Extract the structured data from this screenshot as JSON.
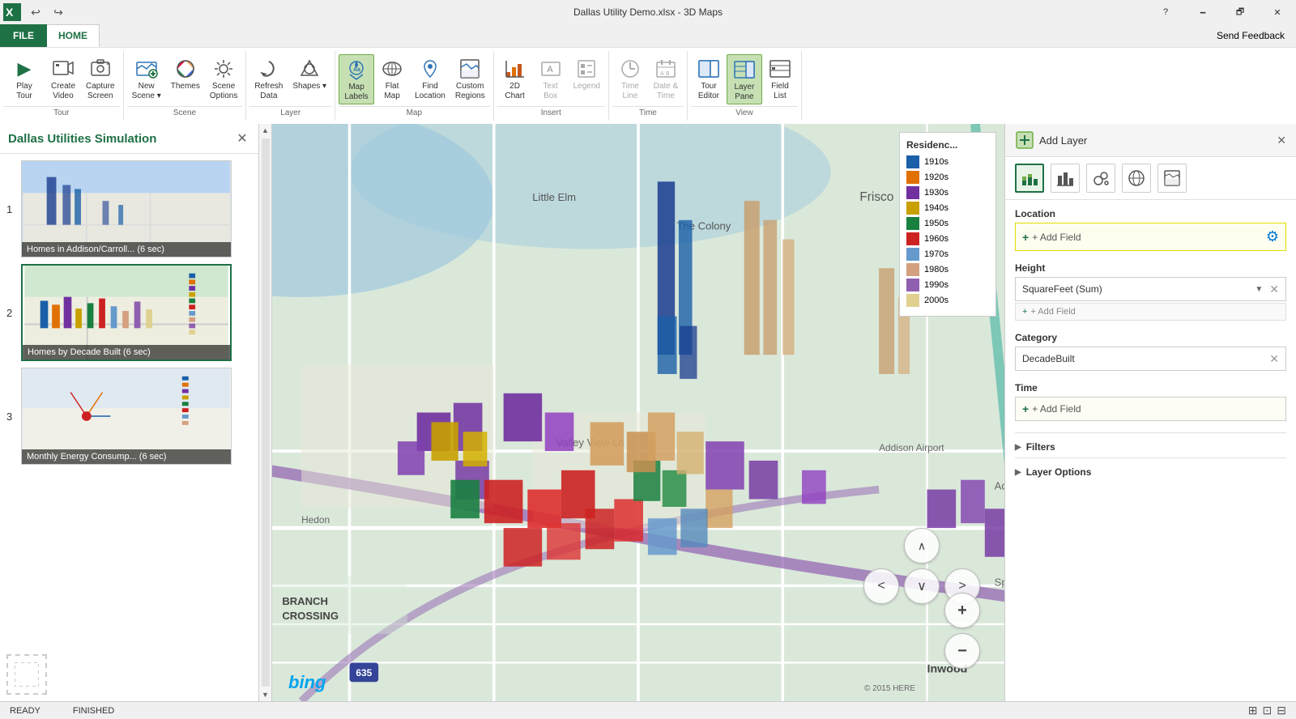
{
  "titlebar": {
    "title": "Dallas Utility Demo.xlsx - 3D Maps",
    "help": "?",
    "minimize": "🗕",
    "maximize": "🗗",
    "close": "✕",
    "undo": "↩",
    "redo": "↪"
  },
  "tabs": {
    "file": "FILE",
    "home": "HOME",
    "send_feedback": "Send Feedback"
  },
  "ribbon_groups": {
    "tour": {
      "label": "Tour",
      "buttons": [
        {
          "id": "play-tour",
          "label": "Play\nTour",
          "icon": "▶",
          "icon_color": "green"
        },
        {
          "id": "create-video",
          "label": "Create\nVideo",
          "icon": "🎬"
        },
        {
          "id": "capture-screen",
          "label": "Capture\nScreen",
          "icon": "📷"
        }
      ]
    },
    "scene": {
      "label": "Scene",
      "buttons": [
        {
          "id": "new-scene",
          "label": "New\nScene",
          "icon": "🏔",
          "has_arrow": true
        },
        {
          "id": "themes",
          "label": "Themes",
          "icon": "🎨"
        },
        {
          "id": "scene-options",
          "label": "Scene\nOptions",
          "icon": "⚙"
        }
      ]
    },
    "layer": {
      "label": "Layer",
      "buttons": [
        {
          "id": "refresh-data",
          "label": "Refresh\nData",
          "icon": "🔄"
        },
        {
          "id": "shapes",
          "label": "Shapes",
          "icon": "⬡",
          "has_arrow": true
        }
      ]
    },
    "map": {
      "label": "Map",
      "buttons": [
        {
          "id": "map-labels",
          "label": "Map\nLabels",
          "icon": "🗺",
          "active": true
        },
        {
          "id": "flat-map",
          "label": "Flat\nMap",
          "icon": "📋"
        },
        {
          "id": "find-location",
          "label": "Find\nLocation",
          "icon": "📍"
        },
        {
          "id": "custom-regions",
          "label": "Custom\nRegions",
          "icon": "🗾"
        }
      ]
    },
    "insert": {
      "label": "Insert",
      "buttons": [
        {
          "id": "2d-chart",
          "label": "2D\nChart",
          "icon": "📊"
        },
        {
          "id": "text-box",
          "label": "Text\nBox",
          "icon": "🔤",
          "disabled": true
        },
        {
          "id": "legend",
          "label": "Legend",
          "icon": "📋",
          "disabled": true
        }
      ]
    },
    "time": {
      "label": "Time",
      "buttons": [
        {
          "id": "time-line",
          "label": "Time\nLine",
          "icon": "⏱",
          "disabled": true
        },
        {
          "id": "date-time",
          "label": "Date &\nTime",
          "icon": "📅",
          "disabled": true
        }
      ]
    },
    "view": {
      "label": "View",
      "buttons": [
        {
          "id": "tour-editor",
          "label": "Tour\nEditor",
          "icon": "🎬"
        },
        {
          "id": "layer-pane",
          "label": "Layer\nPane",
          "icon": "▦",
          "active": true
        },
        {
          "id": "field-list",
          "label": "Field\nList",
          "icon": "📋"
        }
      ]
    }
  },
  "scene_panel": {
    "title": "Dallas Utilities Simulation",
    "scenes": [
      {
        "num": "1",
        "caption": "Homes in Addison/Carroll...  (6 sec)",
        "selected": false
      },
      {
        "num": "2",
        "caption": "Homes by Decade Built      (6 sec)",
        "selected": true
      },
      {
        "num": "3",
        "caption": "Monthly Energy Consump...  (6 sec)",
        "selected": false
      }
    ]
  },
  "legend": {
    "title": "Residenc...",
    "items": [
      {
        "label": "1910s",
        "color": "#1a5fa8"
      },
      {
        "label": "1920s",
        "color": "#e07000"
      },
      {
        "label": "1930s",
        "color": "#7030a0"
      },
      {
        "label": "1940s",
        "color": "#c8a000"
      },
      {
        "label": "1950s",
        "color": "#1a8040"
      },
      {
        "label": "1960s",
        "color": "#cc2222"
      },
      {
        "label": "1970s",
        "color": "#6699cc"
      },
      {
        "label": "1980s",
        "color": "#d4a080"
      },
      {
        "label": "1990s",
        "color": "#9060b0"
      },
      {
        "label": "2000s",
        "color": "#e0d090"
      }
    ]
  },
  "right_panel": {
    "add_layer_label": "Add Layer",
    "location_label": "Location",
    "location_placeholder": "+ Add Field",
    "height_label": "Height",
    "height_value": "SquareFeet (Sum)",
    "height_add": "+ Add Field",
    "category_label": "Category",
    "category_value": "DecadeBuilt",
    "time_label": "Time",
    "time_placeholder": "+ Add Field",
    "filters_label": "Filters",
    "layer_options_label": "Layer Options"
  },
  "status_bar": {
    "ready": "READY",
    "finished": "FINISHED"
  },
  "map": {
    "copyright": "© 2015 HERE",
    "bing": "bing"
  }
}
